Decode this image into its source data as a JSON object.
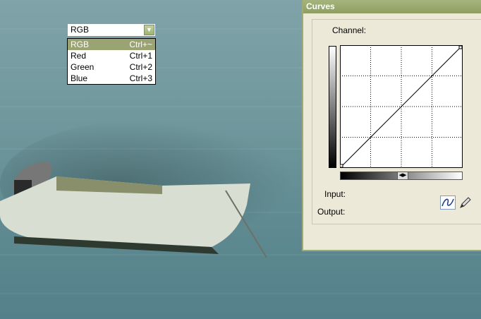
{
  "dialog": {
    "title": "Curves",
    "channel_label": "Channel:",
    "channel_value": "RGB",
    "channel_options": [
      {
        "name": "RGB",
        "shortcut": "Ctrl+~",
        "selected": true
      },
      {
        "name": "Red",
        "shortcut": "Ctrl+1",
        "selected": false
      },
      {
        "name": "Green",
        "shortcut": "Ctrl+2",
        "selected": false
      },
      {
        "name": "Blue",
        "shortcut": "Ctrl+3",
        "selected": false
      }
    ],
    "input_label": "Input:",
    "output_label": "Output:",
    "tools": [
      "curve-tool-icon",
      "pencil-icon"
    ],
    "accent_color": "#9aa472"
  }
}
